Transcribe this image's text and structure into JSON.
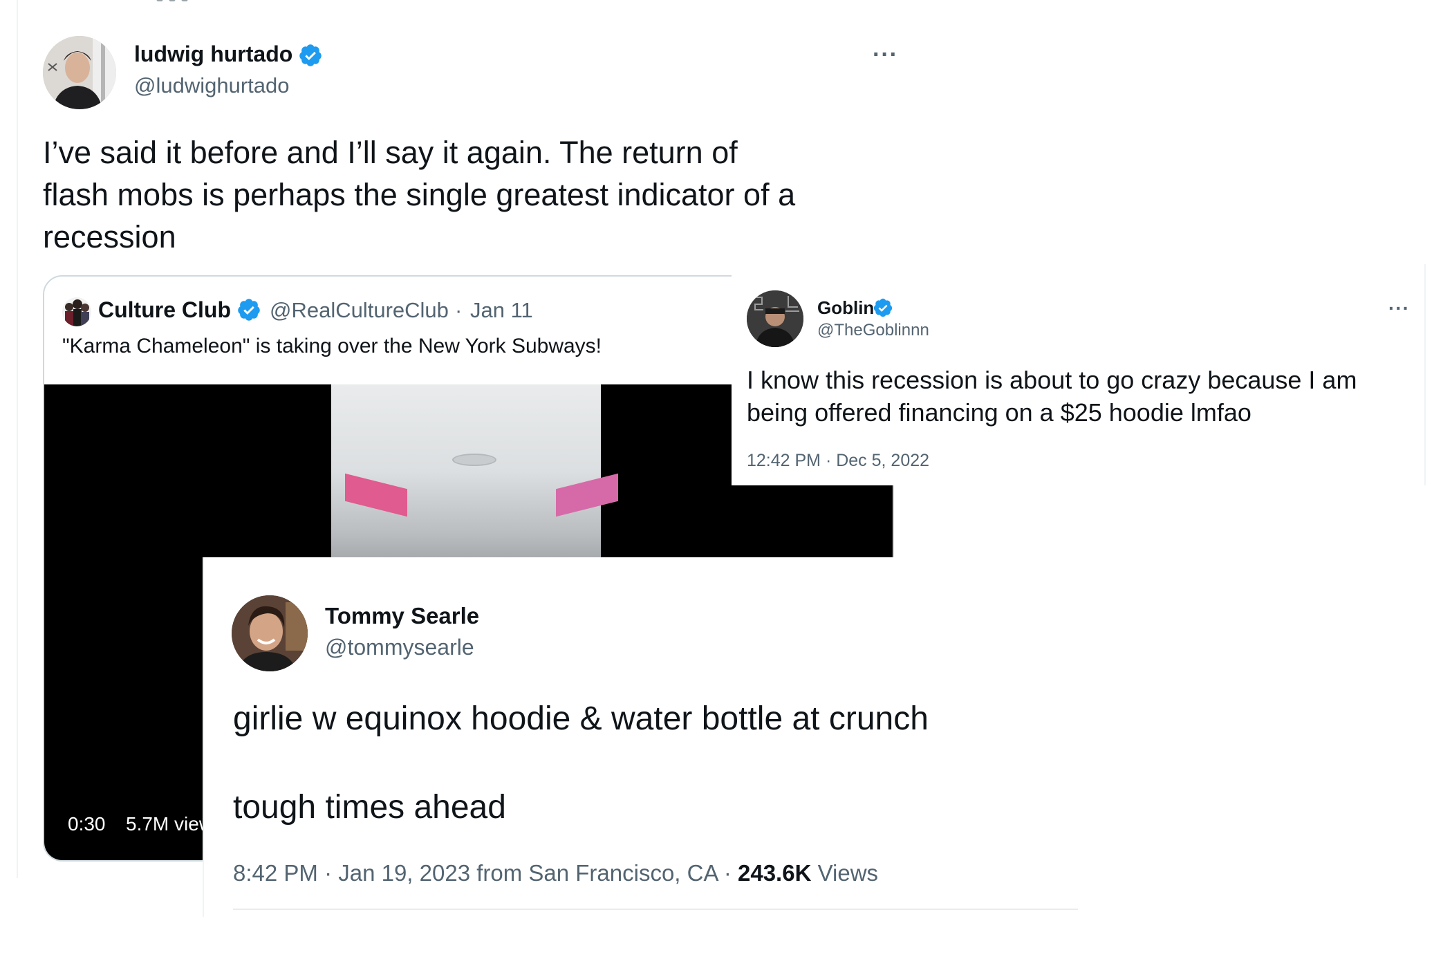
{
  "colors": {
    "verified": "#1d9bf0",
    "text": "#0f1419",
    "secondary": "#536471",
    "border": "#cfd9de",
    "video_bg": "#000000"
  },
  "tweet_ludwig": {
    "name": "ludwig hurtado",
    "handle": "@ludwighurtado",
    "more": "···",
    "text_lines": [
      "I’ve said it before and I’ll say it again. The return of",
      "flash mobs is perhaps the single greatest indicator of a",
      "recession"
    ],
    "quote": {
      "name": "Culture Club",
      "handle": "@RealCultureClub",
      "separator": "·",
      "date": "Jan 11",
      "text": "\"Karma Chameleon\" is taking over the New York Subways!",
      "video_duration": "0:30",
      "video_views": "5.7M views"
    }
  },
  "tweet_goblin": {
    "name": "Goblin",
    "handle": "@TheGoblinnn",
    "more": "···",
    "text_lines": [
      "I know this recession is about to go crazy because I am",
      "being offered financing on a $25 hoodie lmfao"
    ],
    "timestamp": "12:42 PM · Dec 5, 2022"
  },
  "tweet_tommy": {
    "name": "Tommy Searle",
    "handle": "@tommysearle",
    "line1": "girlie w equinox hoodie & water bottle at crunch",
    "line2": "tough times ahead",
    "meta_prefix": "8:42 PM · Jan 19, 2023 from San Francisco, CA · ",
    "views_count": "243.6K",
    "views_label": " Views"
  }
}
